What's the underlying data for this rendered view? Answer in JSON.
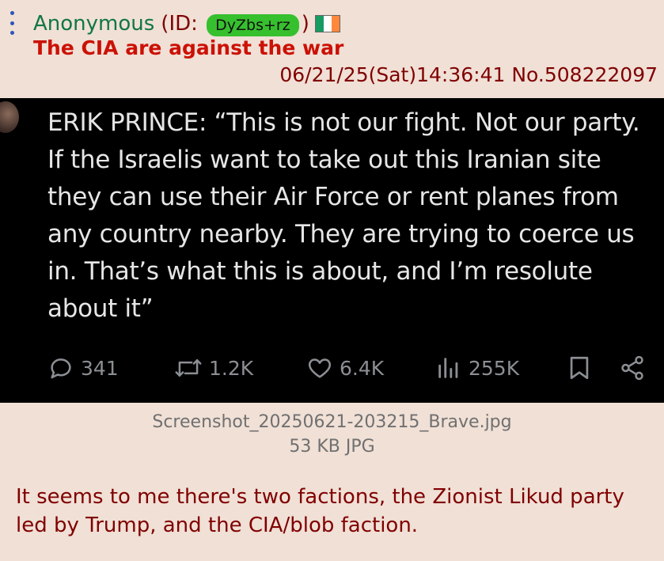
{
  "post": {
    "poster_name": "Anonymous",
    "id_prefix": "(ID:",
    "id_value": "DyZbs+rz",
    "id_suffix": ")",
    "flag": {
      "name": "ireland-flag-icon",
      "colors": [
        "#169B62",
        "#FFFFFF",
        "#FF883E"
      ]
    },
    "subject": "The CIA are against the war",
    "datetime": "06/21/25(Sat)14:36:41",
    "post_number": "No.508222097",
    "comment": "It seems to me there's two factions, the Zionist Likud party led by Trump, and the CIA/blob faction."
  },
  "image": {
    "tweet_text": "ERIK PRINCE: “This is not our fight. Not our party. If the Israelis want to take out this Iranian site they can use their Air Force or rent planes from any country nearby. They are trying to coerce us in. That’s what this is about, and I’m resolute about it”",
    "actions": [
      {
        "icon": "reply-icon",
        "count": "341"
      },
      {
        "icon": "retweet-icon",
        "count": "1.2K"
      },
      {
        "icon": "heart-icon",
        "count": "6.4K"
      },
      {
        "icon": "views-icon",
        "count": "255K"
      },
      {
        "icon": "bookmark-icon",
        "count": ""
      },
      {
        "icon": "share-icon",
        "count": ""
      }
    ]
  },
  "file": {
    "filename": "Screenshot_20250621-203215_Brave.jpg",
    "size_info": "53 KB JPG"
  },
  "colors": {
    "background": "#F0E0D6",
    "name": "#117743",
    "subject": "#CC1105",
    "meta": "#800000",
    "id_badge": "#36C02E",
    "menu_dots": "#2F55B8"
  }
}
